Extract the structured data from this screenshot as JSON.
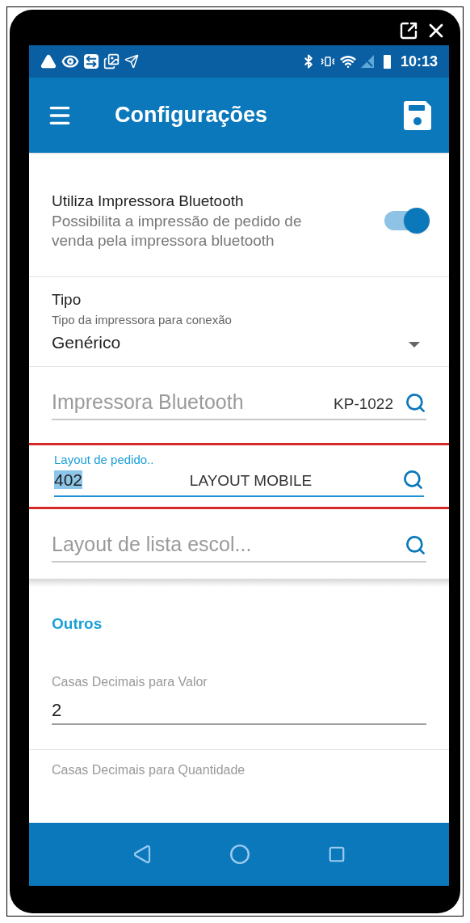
{
  "app_bar": {
    "title": "Configurações"
  },
  "status_bar": {
    "time": "10:13"
  },
  "printer_settings": [
    {
      "kind": "switch",
      "title": "Utiliza Impressora Bluetooth",
      "description": "Possibilita a impressão de pedido de venda pela impressora bluetooth",
      "on": true
    },
    {
      "kind": "dropdown",
      "title": "Tipo",
      "description": "Tipo da impressora para conexão",
      "value": "Genérico"
    },
    {
      "kind": "lookup",
      "placeholder": "Impressora Bluetooth",
      "detail": "KP-1022",
      "focused": false,
      "highlighted": false
    },
    {
      "kind": "lookup",
      "label": "Layout de pedido..",
      "value": "402",
      "value_selected": true,
      "detail": "LAYOUT MOBILE",
      "focused": true,
      "highlighted": true
    },
    {
      "kind": "lookup",
      "placeholder": "Layout de lista escol...",
      "focused": false,
      "highlighted": false
    }
  ],
  "others_section": {
    "title": "Outros",
    "fields": [
      {
        "label": "Casas Decimais para Valor",
        "value": "2"
      },
      {
        "label": "Casas Decimais para Quantidade"
      }
    ]
  }
}
